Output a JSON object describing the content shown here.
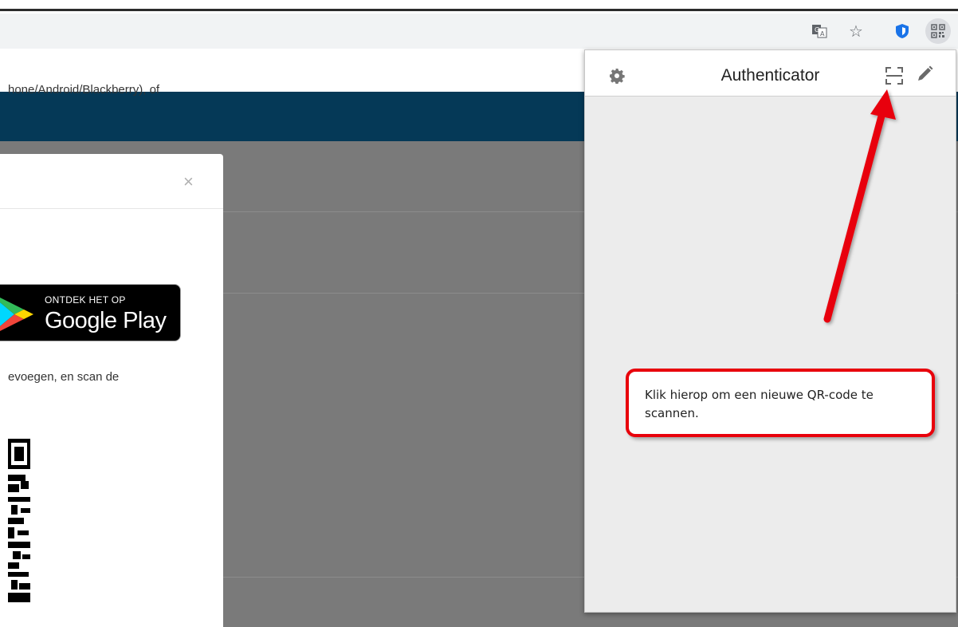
{
  "browser": {
    "toolbar_icons": [
      "translate-icon",
      "star-icon",
      "shield-icon",
      "qr-extension-icon"
    ]
  },
  "modal": {
    "close": "×",
    "line1": "hone/Android/Blackberry), of",
    "line2": "",
    "line3": "evoegen, en scan de",
    "google_play": {
      "pretext": "ONTDEK HET OP",
      "label": "Google Play"
    }
  },
  "authenticator_popup": {
    "title": "Authenticator",
    "icons": [
      "gear-icon",
      "scan-qr-icon",
      "pencil-icon"
    ]
  },
  "callout": {
    "text": "Klik hierop om een nieuwe QR-code te scannen."
  },
  "colors": {
    "header_blue": "#053957",
    "overlay_gray": "#7a7a7a",
    "annotation_red": "#e8000b",
    "popup_bg": "#ececec"
  }
}
